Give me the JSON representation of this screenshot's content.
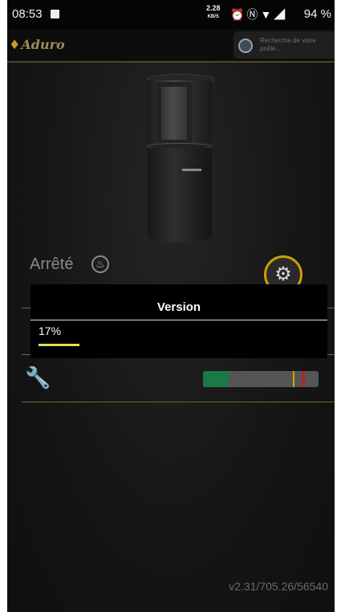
{
  "status_bar": {
    "time": "08:53",
    "net_speed": "2.28",
    "net_speed_unit": "KB/S",
    "battery": "94 %"
  },
  "app_bar": {
    "logo": "Aduro",
    "search_placeholder": "Recherche de votre poêle..."
  },
  "main": {
    "stove_state": "Arrêté",
    "heat_bar_level_percent": 22
  },
  "dialog": {
    "title": "Version",
    "progress_text": "17%",
    "progress_value": 17
  },
  "footer": {
    "version": "v2.31/705.26/56540"
  },
  "colors": {
    "accent_yellow": "#e3e05a",
    "divider": "#6b6b35",
    "bar_green": "#1a7a45",
    "bar_red_mark": "#c02020"
  }
}
